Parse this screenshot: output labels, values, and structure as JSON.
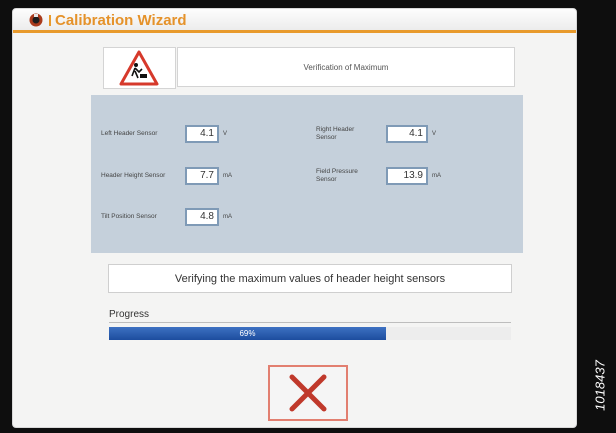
{
  "window": {
    "title": "Calibration Wizard",
    "accent_color": "#e89a2c",
    "icon": "machine-icon"
  },
  "warning": {
    "icon": "warning-triangle-icon"
  },
  "header": {
    "title": "Verification of Maximum"
  },
  "sensors": [
    {
      "label": "Left Header Sensor",
      "value": "4.1",
      "unit": "V"
    },
    {
      "label": "Header Height Sensor",
      "value": "7.7",
      "unit": "mA"
    },
    {
      "label": "Tilt Position Sensor",
      "value": "4.8",
      "unit": "mA"
    },
    {
      "label": "Right Header Sensor",
      "value": "4.1",
      "unit": "V"
    },
    {
      "label": "Field Pressure Sensor",
      "value": "13.9",
      "unit": "mA"
    }
  ],
  "status": {
    "text": "Verifying the maximum values of header height sensors"
  },
  "progress": {
    "label": "Progress",
    "percent": 69,
    "text": "69%",
    "color": "#2a5db0"
  },
  "cancel": {
    "icon": "close-x-icon",
    "color": "#c0392b"
  },
  "figure_code": "1018437"
}
